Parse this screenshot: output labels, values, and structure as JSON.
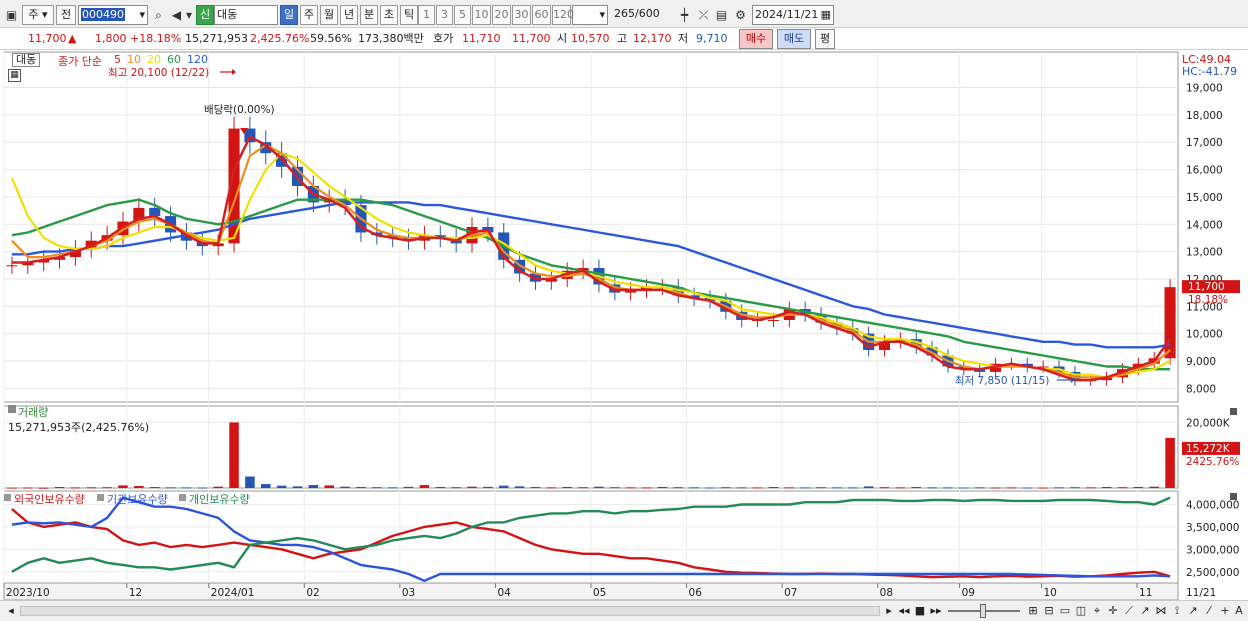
{
  "toolbar": {
    "type_select": "주",
    "prev_label": "전",
    "code": "000490",
    "sin_label": "신",
    "name": "대동",
    "periods": [
      "일",
      "주",
      "월",
      "년",
      "분",
      "초",
      "틱"
    ],
    "active_period": "일",
    "intervals": [
      "1",
      "3",
      "5",
      "10",
      "20",
      "30",
      "60",
      "120"
    ],
    "count": "265",
    "count_total": "/600",
    "date": "2024/11/21"
  },
  "quote": {
    "price": "11,700",
    "change": "1,800",
    "change_pct": "+18.18%",
    "volume": "15,271,953",
    "volume_pct": "2,425.76%",
    "ratio": "59.56%",
    "amount": "173,380백만",
    "hoga_label": "호가",
    "hoga_bid": "11,710",
    "hoga_ask": "11,700",
    "open_label": "시",
    "open": "10,570",
    "high_label": "고",
    "high": "12,170",
    "low_label": "저",
    "low": "9,710",
    "buy_label": "매수",
    "sell_label": "매도",
    "flat_label": "평"
  },
  "price_panel": {
    "stock_tag": "대동",
    "ma_title": "종가 단순",
    "ma_periods": [
      "5",
      "10",
      "20",
      "60",
      "120"
    ],
    "ma_colors": [
      "#d42020",
      "#f08c1e",
      "#f0e000",
      "#2a9a46",
      "#2a5ad8"
    ],
    "max_label": "최고 20,100 (12/22)",
    "min_label": "최저 7,850 (11/15)",
    "dividend_label": "배당락(0.00%)",
    "lc": "LC:49.04",
    "hc": "HC:-41.79",
    "price_tag": "11,700",
    "pct_tag": "18.18%"
  },
  "volume_panel": {
    "title": "거래량",
    "info": "15,271,953주(2,425.76%)",
    "tag": "15,272K",
    "tag_pct": "2425.76%",
    "color": "#d42020"
  },
  "holding_panel": {
    "items": [
      {
        "label": "외국인보유수량",
        "color": "#d21414"
      },
      {
        "label": "기관보유수량",
        "color": "#2a55d8"
      },
      {
        "label": "개인보유수량",
        "color": "#228b57"
      }
    ]
  },
  "chart_data": [
    {
      "type": "line",
      "title": "",
      "x_labels": [
        "2023/10",
        "12",
        "2024/01",
        "02",
        "03",
        "04",
        "05",
        "06",
        "07",
        "08",
        "09",
        "10",
        "11",
        "11/21"
      ],
      "ylim": [
        7500,
        20300
      ],
      "yticks": [
        8000,
        9000,
        10000,
        11000,
        12000,
        13000,
        14000,
        15000,
        16000,
        17000,
        18000,
        19000
      ],
      "close": [
        12500,
        12600,
        12700,
        12800,
        13100,
        13400,
        13600,
        14100,
        14600,
        14300,
        13700,
        13400,
        13200,
        13300,
        17500,
        17000,
        16600,
        16100,
        15400,
        14800,
        14900,
        14700,
        13700,
        13600,
        13500,
        13400,
        13600,
        13500,
        13300,
        13900,
        13700,
        12700,
        12200,
        11900,
        12000,
        12300,
        12400,
        11800,
        11500,
        11600,
        11700,
        11700,
        11400,
        11300,
        11200,
        10800,
        10500,
        10500,
        10500,
        10900,
        10700,
        10400,
        10200,
        10000,
        9400,
        9700,
        9800,
        9500,
        9200,
        8800,
        8700,
        8600,
        8900,
        8900,
        8800,
        8800,
        8600,
        8300,
        8300,
        8400,
        8700,
        8900,
        9100,
        11700
      ],
      "ma5": [
        12600,
        12600,
        12700,
        12800,
        13000,
        13200,
        13500,
        13900,
        14200,
        14300,
        14000,
        13600,
        13300,
        13300,
        16000,
        17200,
        16900,
        16400,
        15700,
        15100,
        14900,
        14600,
        13900,
        13600,
        13500,
        13400,
        13500,
        13500,
        13400,
        13700,
        13800,
        12800,
        12300,
        12000,
        12000,
        12200,
        12300,
        11900,
        11600,
        11600,
        11600,
        11600,
        11400,
        11300,
        11200,
        10900,
        10600,
        10500,
        10600,
        10800,
        10700,
        10400,
        10200,
        10000,
        9500,
        9700,
        9700,
        9500,
        9200,
        8800,
        8700,
        8700,
        8800,
        8900,
        8800,
        8700,
        8500,
        8300,
        8300,
        8400,
        8600,
        8800,
        9000,
        9800
      ],
      "ma10": [
        13400,
        12800,
        12800,
        12900,
        13000,
        13200,
        13400,
        13800,
        14100,
        14200,
        14000,
        13700,
        13400,
        13300,
        14800,
        16500,
        16900,
        16600,
        16000,
        15400,
        15000,
        14700,
        14200,
        13800,
        13600,
        13500,
        13500,
        13500,
        13400,
        13600,
        13700,
        13000,
        12500,
        12200,
        12100,
        12100,
        12200,
        12000,
        11700,
        11600,
        11600,
        11600,
        11500,
        11300,
        11200,
        11000,
        10700,
        10600,
        10600,
        10700,
        10700,
        10500,
        10300,
        10100,
        9700,
        9700,
        9700,
        9600,
        9300,
        9000,
        8800,
        8700,
        8800,
        8800,
        8800,
        8700,
        8600,
        8400,
        8400,
        8400,
        8500,
        8700,
        8900,
        9400
      ],
      "ma20": [
        15700,
        14300,
        13500,
        13200,
        13100,
        13100,
        13200,
        13500,
        13700,
        13900,
        13900,
        13700,
        13500,
        13400,
        13500,
        14900,
        16000,
        16600,
        16400,
        15900,
        15400,
        15000,
        14600,
        14200,
        13900,
        13700,
        13600,
        13500,
        13500,
        13500,
        13600,
        13300,
        12900,
        12500,
        12300,
        12200,
        12200,
        12100,
        11900,
        11800,
        11700,
        11700,
        11600,
        11500,
        11300,
        11200,
        10900,
        10800,
        10700,
        10700,
        10700,
        10600,
        10400,
        10200,
        9900,
        9800,
        9800,
        9700,
        9500,
        9200,
        9000,
        8900,
        8800,
        8800,
        8800,
        8700,
        8700,
        8500,
        8500,
        8400,
        8500,
        8600,
        8700,
        9000
      ],
      "ma60": [
        13600,
        13700,
        13900,
        14100,
        14300,
        14500,
        14700,
        14800,
        14900,
        14700,
        14400,
        14200,
        14100,
        14000,
        14100,
        14300,
        14500,
        14700,
        14900,
        14900,
        14900,
        14900,
        14900,
        14800,
        14700,
        14500,
        14300,
        14100,
        13900,
        13700,
        13500,
        13200,
        12900,
        12700,
        12500,
        12400,
        12300,
        12200,
        12100,
        12000,
        11900,
        11800,
        11700,
        11500,
        11400,
        11300,
        11200,
        11100,
        11000,
        10900,
        10800,
        10700,
        10600,
        10500,
        10400,
        10300,
        10200,
        10100,
        10000,
        9900,
        9700,
        9600,
        9500,
        9400,
        9300,
        9200,
        9100,
        9000,
        8900,
        8800,
        8800,
        8700,
        8700,
        8700
      ],
      "ma120": [
        12900,
        12900,
        13000,
        13000,
        13100,
        13100,
        13200,
        13200,
        13300,
        13400,
        13500,
        13600,
        13700,
        13800,
        14000,
        14200,
        14300,
        14400,
        14500,
        14600,
        14700,
        14800,
        14800,
        14800,
        14800,
        14800,
        14700,
        14700,
        14600,
        14500,
        14400,
        14300,
        14200,
        14100,
        14000,
        13900,
        13800,
        13700,
        13600,
        13500,
        13400,
        13300,
        13200,
        13000,
        12800,
        12600,
        12400,
        12200,
        12000,
        11800,
        11600,
        11400,
        11200,
        11000,
        10900,
        10700,
        10600,
        10500,
        10400,
        10300,
        10200,
        10100,
        10000,
        9900,
        9800,
        9700,
        9700,
        9600,
        9600,
        9500,
        9500,
        9500,
        9500,
        9600
      ]
    },
    {
      "type": "bar",
      "title": "거래량",
      "ylim": [
        0,
        25000
      ],
      "ytick_label": "20,000K",
      "values": [
        120,
        150,
        90,
        300,
        180,
        220,
        250,
        800,
        600,
        300,
        200,
        180,
        150,
        400,
        20000,
        3500,
        1200,
        700,
        500,
        900,
        800,
        400,
        300,
        250,
        200,
        350,
        900,
        300,
        250,
        400,
        350,
        700,
        500,
        300,
        200,
        300,
        250,
        400,
        250,
        200,
        180,
        300,
        250,
        200,
        150,
        250,
        200,
        180,
        300,
        200,
        180,
        250,
        200,
        180,
        500,
        250,
        200,
        300,
        200,
        180,
        150,
        200,
        150,
        180,
        150,
        140,
        200,
        250,
        200,
        300,
        250,
        300,
        400,
        15272
      ]
    },
    {
      "type": "line",
      "title": "보유수량",
      "ylim": [
        2250000,
        4300000
      ],
      "yticks": [
        2500000,
        3000000,
        3500000,
        4000000
      ],
      "ytick_labels": [
        "2,500,000",
        "3,000,000",
        "3,500,000",
        "4,000,000"
      ],
      "series": [
        {
          "name": "외국인보유수량",
          "values": [
            3900000,
            3600000,
            3500000,
            3550000,
            3600000,
            3500000,
            3450000,
            3200000,
            3100000,
            3150000,
            3050000,
            3100000,
            3050000,
            3100000,
            3150000,
            3100000,
            3050000,
            3000000,
            2900000,
            2800000,
            2900000,
            2950000,
            3000000,
            3150000,
            3300000,
            3400000,
            3500000,
            3550000,
            3600000,
            3500000,
            3450000,
            3400000,
            3250000,
            3100000,
            3000000,
            2950000,
            2900000,
            2900000,
            2850000,
            2800000,
            2800000,
            2750000,
            2700000,
            2600000,
            2550000,
            2500000,
            2480000,
            2470000,
            2460000,
            2450000,
            2450000,
            2460000,
            2450000,
            2450000,
            2440000,
            2430000,
            2420000,
            2400000,
            2380000,
            2390000,
            2400000,
            2380000,
            2400000,
            2410000,
            2390000,
            2400000,
            2410000,
            2390000,
            2400000,
            2420000,
            2450000,
            2480000,
            2500000,
            2400000
          ]
        },
        {
          "name": "기관보유수량",
          "values": [
            3550000,
            3600000,
            3580000,
            3600000,
            3550000,
            3500000,
            3700000,
            4150000,
            4050000,
            3950000,
            3950000,
            3900000,
            3800000,
            3700000,
            3400000,
            3200000,
            3150000,
            3100000,
            3100000,
            3050000,
            2950000,
            2800000,
            2650000,
            2600000,
            2550000,
            2450000,
            2300000,
            2450000,
            2450000,
            2450000,
            2450000,
            2450000,
            2450000,
            2450000,
            2450000,
            2450000,
            2450000,
            2450000,
            2450000,
            2450000,
            2450000,
            2450000,
            2450000,
            2450000,
            2450000,
            2450000,
            2450000,
            2450000,
            2450000,
            2450000,
            2450000,
            2450000,
            2450000,
            2450000,
            2450000,
            2450000,
            2450000,
            2450000,
            2450000,
            2450000,
            2450000,
            2450000,
            2450000,
            2450000,
            2440000,
            2430000,
            2420000,
            2410000,
            2400000,
            2400000,
            2400000,
            2400000,
            2420000,
            2400000
          ]
        },
        {
          "name": "개인보유수량",
          "values": [
            2500000,
            2700000,
            2800000,
            2700000,
            2750000,
            2800000,
            2700000,
            2650000,
            2600000,
            2600000,
            2550000,
            2600000,
            2650000,
            2700000,
            2600000,
            3100000,
            3150000,
            3200000,
            3250000,
            3200000,
            3100000,
            3000000,
            3050000,
            3100000,
            3200000,
            3250000,
            3300000,
            3250000,
            3350000,
            3500000,
            3600000,
            3600000,
            3700000,
            3750000,
            3800000,
            3800000,
            3850000,
            3850000,
            3800000,
            3850000,
            3850000,
            3880000,
            3900000,
            3950000,
            3950000,
            3950000,
            4000000,
            4000000,
            4000000,
            4000000,
            4050000,
            4050000,
            4050000,
            4100000,
            4100000,
            4100000,
            4080000,
            4080000,
            4100000,
            4100000,
            4080000,
            4100000,
            4100000,
            4080000,
            4080000,
            4080000,
            4100000,
            4100000,
            4100000,
            4080000,
            4050000,
            4050000,
            4000000,
            4150000
          ]
        }
      ]
    }
  ]
}
